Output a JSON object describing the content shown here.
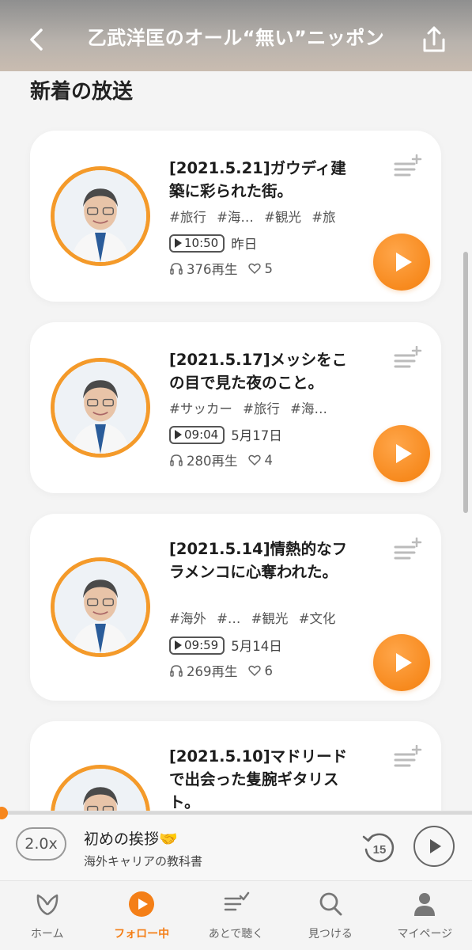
{
  "header": {
    "title": "乙武洋匡のオール“無い”ニッポン"
  },
  "section": {
    "title": "新着の放送"
  },
  "episodes": [
    {
      "title": "[2021.5.21]ガウディ建築に彩られた街。",
      "tags": "#旅行 #海… #観光 #旅",
      "duration": "10:50",
      "date": "昨日",
      "plays": "376再生",
      "likes": "5"
    },
    {
      "title": "[2021.5.17]メッシをこの目で見た夜のこと。",
      "tags": "#サッカー #旅行 #海…",
      "duration": "09:04",
      "date": "5月17日",
      "plays": "280再生",
      "likes": "4"
    },
    {
      "title": "[2021.5.14]情熱的なフラメンコに心奪われた。",
      "tags": "#海外 #… #観光 #文化",
      "duration": "09:59",
      "date": "5月14日",
      "plays": "269再生",
      "likes": "6"
    },
    {
      "title": "[2021.5.10]マドリードで出会った隻腕ギタリスト。"
    }
  ],
  "player": {
    "speed": "2.0x",
    "title": "初めの挨拶🤝",
    "subtitle": "海外キャリアの教科書",
    "replay_seconds": "15"
  },
  "nav": {
    "items": [
      {
        "label": "ホーム",
        "icon": "home-leaf-icon"
      },
      {
        "label": "フォロー中",
        "icon": "following-play-icon",
        "active": true
      },
      {
        "label": "あとで聴く",
        "icon": "listen-later-icon"
      },
      {
        "label": "見つける",
        "icon": "search-icon"
      },
      {
        "label": "マイページ",
        "icon": "person-icon"
      }
    ]
  },
  "colors": {
    "accent": "#f7871d",
    "header_bg": "#a9a39e",
    "card_bg": "#ffffff",
    "page_bg": "#f4f4f4"
  }
}
